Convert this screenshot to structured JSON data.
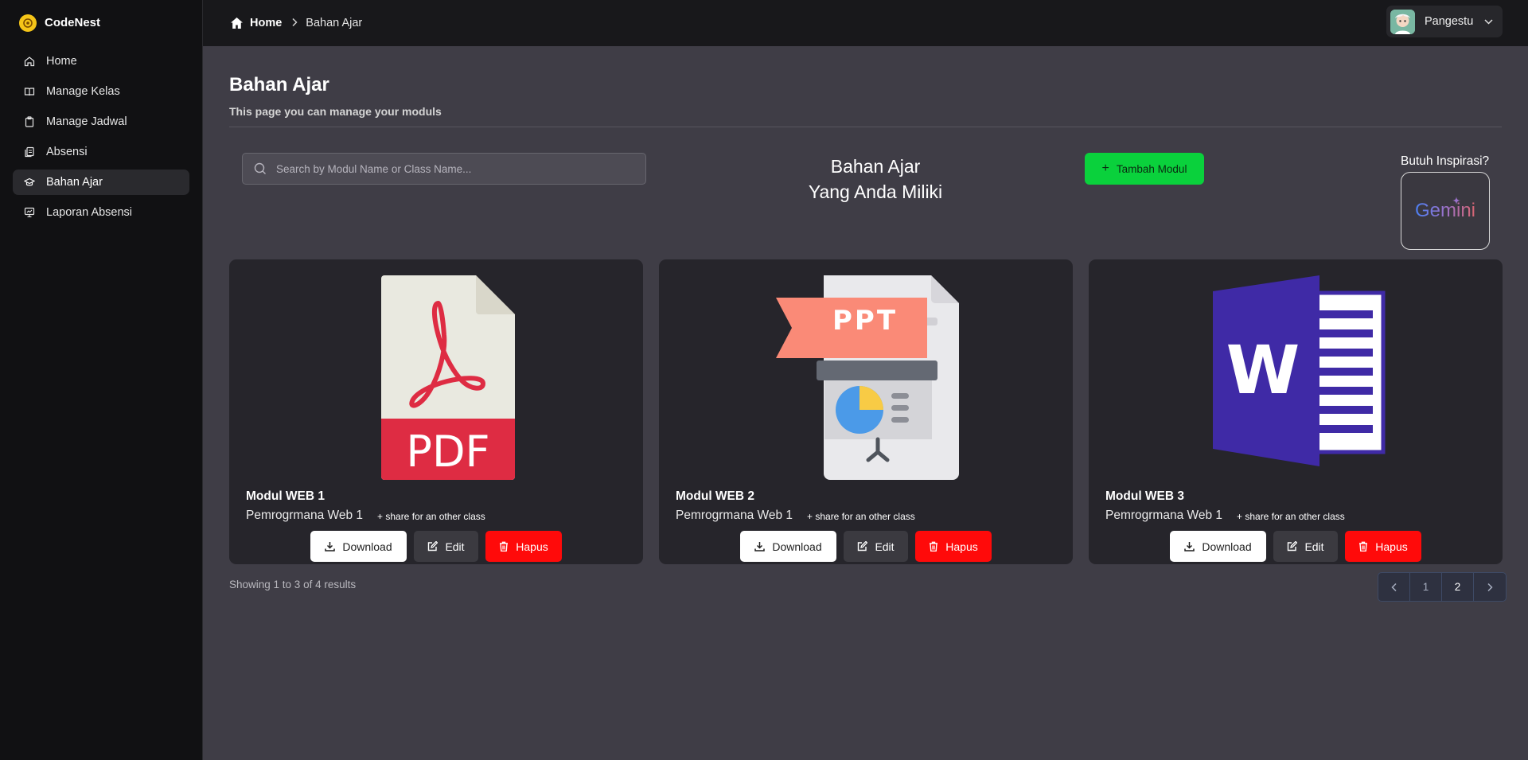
{
  "app": {
    "name": "CodeNest",
    "logo_icon": "codenest-logo-icon"
  },
  "sidebar": {
    "items": [
      {
        "label": "Home",
        "icon": "home-icon",
        "active": false
      },
      {
        "label": "Manage Kelas",
        "icon": "book-icon",
        "active": false
      },
      {
        "label": "Manage Jadwal",
        "icon": "clipboard-icon",
        "active": false
      },
      {
        "label": "Absensi",
        "icon": "documents-icon",
        "active": false
      },
      {
        "label": "Bahan Ajar",
        "icon": "graduation-cap-icon",
        "active": true
      },
      {
        "label": "Laporan Absensi",
        "icon": "presentation-icon",
        "active": false
      }
    ]
  },
  "topbar": {
    "breadcrumb": {
      "home": "Home",
      "current": "Bahan Ajar"
    },
    "user": {
      "name": "Pangestu"
    }
  },
  "page": {
    "title": "Bahan Ajar",
    "subtitle": "This page you can manage your moduls",
    "heading_line1": "Bahan Ajar",
    "heading_line2": "Yang Anda Miliki"
  },
  "search": {
    "placeholder": "Search by Modul Name or Class Name..."
  },
  "actions": {
    "add_label": "Tambah Modul"
  },
  "gemini": {
    "label": "Butuh Inspirasi?",
    "logo_text": "Gemini"
  },
  "cards": [
    {
      "title": "Modul WEB 1",
      "class": "Pemrogrmana Web 1",
      "share": "+ share for an other class",
      "file_type": "PDF",
      "icon": "pdf-file-icon"
    },
    {
      "title": "Modul WEB 2",
      "class": "Pemrogrmana Web 1",
      "share": "+ share for an other class",
      "file_type": "PPT",
      "icon": "ppt-file-icon"
    },
    {
      "title": "Modul WEB 3",
      "class": "Pemrogrmana Web 1",
      "share": "+ share for an other class",
      "file_type": "W",
      "icon": "word-file-icon"
    }
  ],
  "card_buttons": {
    "download": "Download",
    "edit": "Edit",
    "delete": "Hapus"
  },
  "pagination": {
    "summary": "Showing 1 to 3 of 4 results",
    "pages": [
      "1",
      "2"
    ],
    "current": "2"
  },
  "colors": {
    "accent_green": "#0ad13c",
    "danger_red": "#ff0a0a",
    "sidebar_bg": "#111113",
    "main_bg": "#3f3d46"
  }
}
